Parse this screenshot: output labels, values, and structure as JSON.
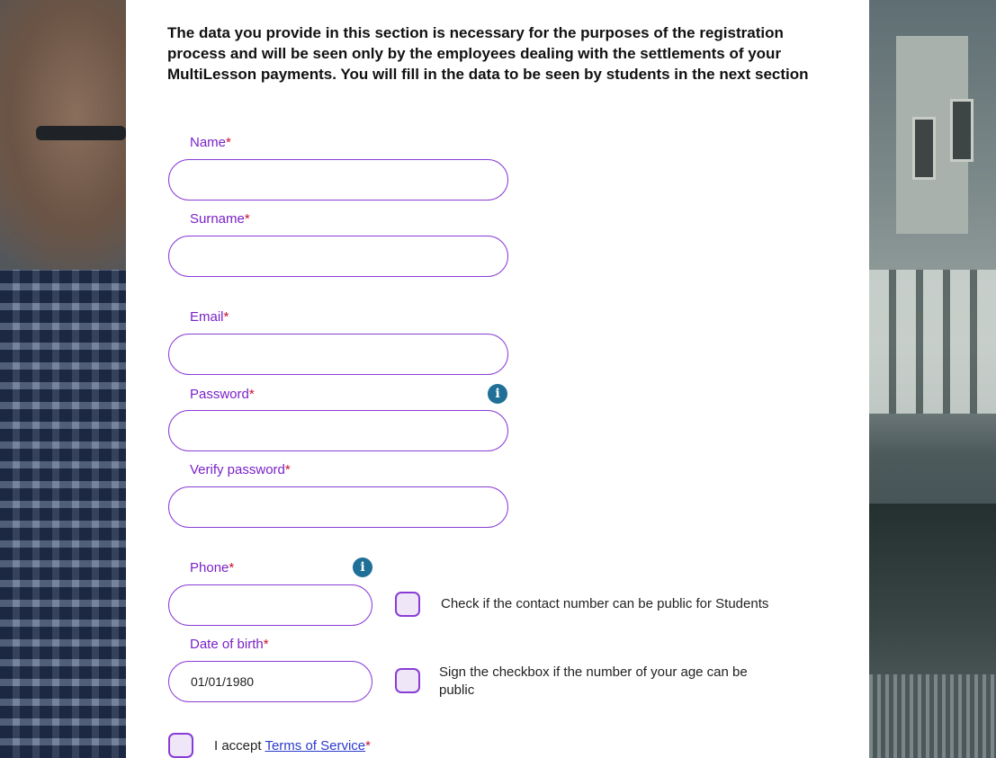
{
  "intro": "The data you provide in this section is necessary for the purposes of the registration process and will be seen only by the employees dealing with the settlements of your MultiLesson payments. You will fill in the data to be seen by students in the next section",
  "required_mark": "*",
  "fields": {
    "name": {
      "label": "Name",
      "value": ""
    },
    "surname": {
      "label": "Surname",
      "value": ""
    },
    "email": {
      "label": "Email",
      "value": ""
    },
    "password": {
      "label": "Password",
      "value": ""
    },
    "verify_password": {
      "label": "Verify password",
      "value": ""
    },
    "phone": {
      "label": "Phone",
      "value": ""
    },
    "dob": {
      "label": "Date of birth",
      "value": "01/01/1980"
    }
  },
  "checkboxes": {
    "phone_public": "Check if the contact number can be public for Students",
    "age_public": "Sign the checkbox if the number of your age can be public",
    "terms_prefix": "I accept ",
    "terms_link": "Terms of Service"
  },
  "icons": {
    "info": "i"
  },
  "colors": {
    "accent": "#8a3dd6",
    "label": "#7a22c9",
    "required": "#c8102e",
    "info": "#1f6f97",
    "link": "#2a3acb"
  }
}
